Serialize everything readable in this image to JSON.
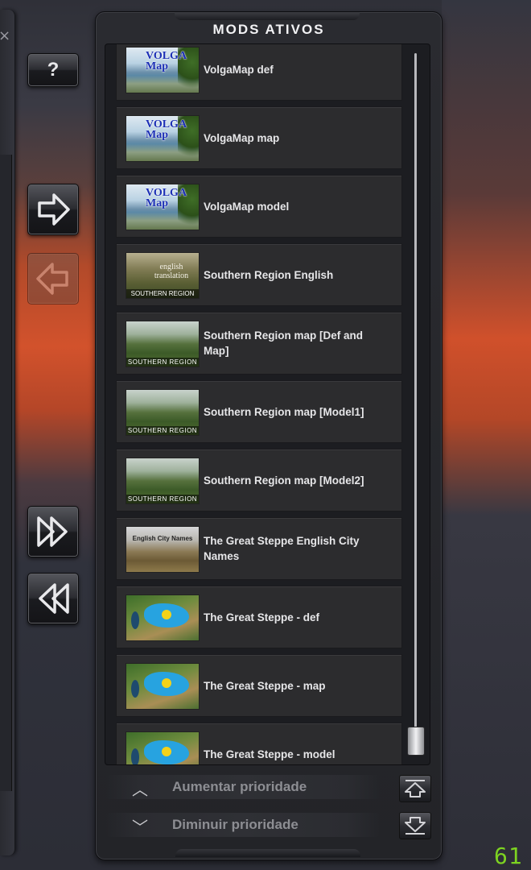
{
  "panel": {
    "title": "MODS ATIVOS"
  },
  "side_buttons": {
    "help_label": "?",
    "add_icon": "arrow-right-icon",
    "remove_icon": "arrow-left-icon",
    "add_all_icon": "double-arrow-right-icon",
    "remove_all_icon": "double-arrow-left-icon"
  },
  "mods": [
    {
      "name": "VolgaMap def",
      "thumb": "volga",
      "thumb_logo": "VOLGA Map"
    },
    {
      "name": "VolgaMap map",
      "thumb": "volga",
      "thumb_logo": "VOLGA Map"
    },
    {
      "name": "VolgaMap model",
      "thumb": "volga",
      "thumb_logo": "VOLGA Map"
    },
    {
      "name": "Southern Region English",
      "thumb": "english",
      "thumb_text": "english translation",
      "thumb_caption": "SOUTHERN REGION"
    },
    {
      "name": "Southern Region map [Def and Map]",
      "thumb": "south",
      "thumb_caption": "SOUTHERN REGION"
    },
    {
      "name": "Southern Region map [Model1]",
      "thumb": "south",
      "thumb_caption": "SOUTHERN REGION"
    },
    {
      "name": "Southern Region map [Model2]",
      "thumb": "south",
      "thumb_caption": "SOUTHERN REGION"
    },
    {
      "name": "The Great Steppe English City Names",
      "thumb": "steppe-en",
      "thumb_text": "English City Names"
    },
    {
      "name": "The Great Steppe - def",
      "thumb": "kz"
    },
    {
      "name": "The Great Steppe - map",
      "thumb": "kz"
    },
    {
      "name": "The Great Steppe - model",
      "thumb": "kz"
    }
  ],
  "priority": {
    "increase_label": "Aumentar prioridade",
    "decrease_label": "Diminuir prioridade",
    "increase_icon": "chevron-up-icon",
    "decrease_icon": "chevron-down-icon"
  },
  "fps_counter": "61",
  "colors": {
    "accent_fps": "#7dd321",
    "list_item_bg": "#2c2c2e",
    "text": "#e6e6e8"
  }
}
